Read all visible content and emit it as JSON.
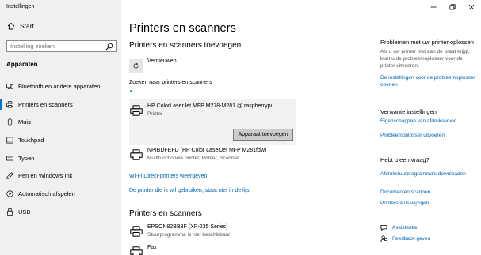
{
  "window": {
    "title": "Instellingen"
  },
  "sidebar": {
    "home_label": "Start",
    "search_placeholder": "Instelling zoeken",
    "section": "Apparaten",
    "items": [
      {
        "label": "Bluetooth en andere apparaten",
        "icon": "bluetooth-icon"
      },
      {
        "label": "Printers en scanners",
        "icon": "printer-icon",
        "active": true
      },
      {
        "label": "Muis",
        "icon": "mouse-icon"
      },
      {
        "label": "Touchpad",
        "icon": "touchpad-icon"
      },
      {
        "label": "Typen",
        "icon": "keyboard-icon"
      },
      {
        "label": "Pen en Windows Ink",
        "icon": "pen-icon"
      },
      {
        "label": "Automatisch afspelen",
        "icon": "autoplay-icon"
      },
      {
        "label": "USB",
        "icon": "usb-icon"
      }
    ]
  },
  "main": {
    "title": "Printers en scanners",
    "add_section": "Printers en scanners toevoegen",
    "refresh_label": "Vernieuwen",
    "searching_label": "Zoeken naar printers en scanners",
    "found": [
      {
        "name": "HP ColorLaserJet MFP M278-M281 @ raspberrypi",
        "sub": "Printer",
        "button": "Apparaat toevoegen"
      },
      {
        "name": "NPIBDFEFD (HP Color LaserJet MFP M281fdw)",
        "sub": "Multifunctionele printer, Printer, Scanner"
      }
    ],
    "link_wifi": "Wi-Fi Direct-printers weergeven",
    "link_not_listed": "De printer die ik wil gebruiken, staat niet in de lijst",
    "list_section": "Printers en scanners",
    "installed": [
      {
        "name": "EPSON82BB3F (XP-235 Series)",
        "sub": "Stuurprogramma is niet beschikbaar"
      },
      {
        "name": "Fax",
        "sub": ""
      }
    ]
  },
  "right_panel": {
    "problems_title": "Problemen met uw printer oplossen",
    "problems_text": "Als u uw printer niet aan de praat krijgt, kunt u de probleemoplosser voor de printer uitvoeren.",
    "problems_link": "De instellingen voor de probleemoplosser openen",
    "related_title": "Verwante instellingen",
    "related_links": [
      "Eigenschappen van afdrukserver",
      "Probleemoplosser uitvoeren"
    ],
    "help_title": "Hebt u een vraag?",
    "help_links": [
      "Afdrukstuurprogramma's downloaden",
      "Documenten scannen",
      "Printerstatus wijzigen"
    ],
    "assist_label": "Assistentie",
    "feedback_label": "Feedback geven"
  },
  "colors": {
    "accent": "#0078d7",
    "link": "#0063b1",
    "sidebar_bg": "#f0f0f0",
    "card_bg": "#f2f2f2"
  }
}
